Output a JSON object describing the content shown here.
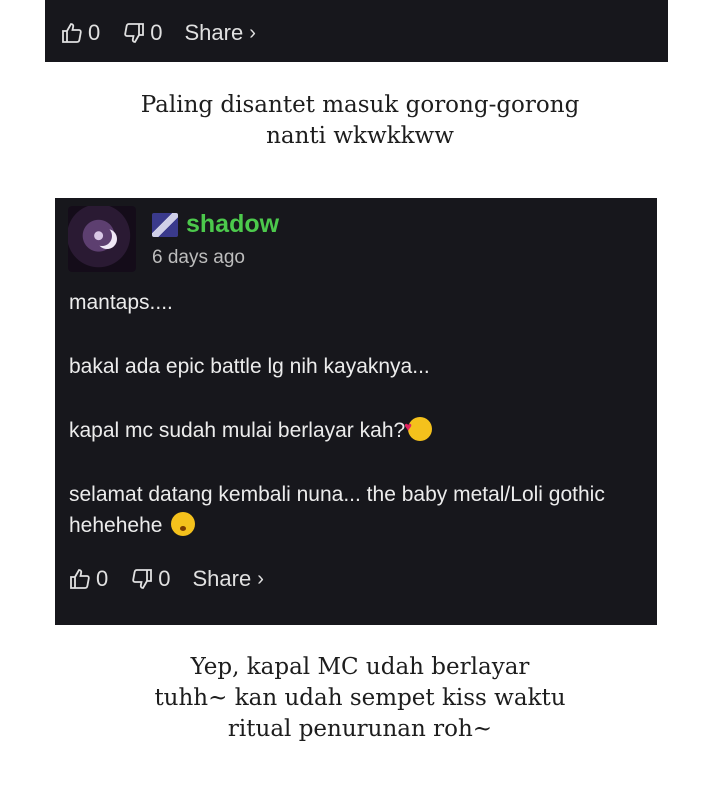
{
  "top_actions": {
    "like_count": "0",
    "dislike_count": "0",
    "share_label": "Share"
  },
  "caption_1": [
    "Paling disantet masuk gorong-gorong",
    "nanti wkwkkww"
  ],
  "comment": {
    "username": "shadow",
    "timestamp": "6 days ago",
    "lines": [
      "mantaps....",
      "bakal ada epic battle lg nih kayaknya...",
      "kapal mc sudah mulai berlayar kah?",
      "selamat datang kembali nuna... the baby metal/Loli gothic hehehehe"
    ],
    "actions": {
      "like_count": "0",
      "dislike_count": "0",
      "share_label": "Share"
    }
  },
  "caption_2": [
    "Yep, kapal MC udah berlayar",
    "tuhh~ kan udah sempet kiss waktu",
    "ritual penurunan roh~"
  ],
  "icons": [
    "thumbs-up-icon",
    "thumbs-down-icon",
    "chevron-right-icon",
    "hearts-face-emoji",
    "kissing-face-emoji"
  ],
  "colors": {
    "card_bg": "#17171c",
    "username": "#4cc94c"
  }
}
